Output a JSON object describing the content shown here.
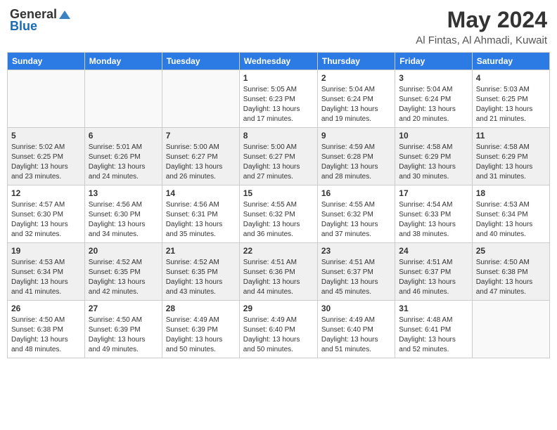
{
  "header": {
    "logo_general": "General",
    "logo_blue": "Blue",
    "month_title": "May 2024",
    "location": "Al Fintas, Al Ahmadi, Kuwait"
  },
  "days_of_week": [
    "Sunday",
    "Monday",
    "Tuesday",
    "Wednesday",
    "Thursday",
    "Friday",
    "Saturday"
  ],
  "weeks": [
    [
      {
        "day": "",
        "info": ""
      },
      {
        "day": "",
        "info": ""
      },
      {
        "day": "",
        "info": ""
      },
      {
        "day": "1",
        "info": "Sunrise: 5:05 AM\nSunset: 6:23 PM\nDaylight: 13 hours\nand 17 minutes."
      },
      {
        "day": "2",
        "info": "Sunrise: 5:04 AM\nSunset: 6:24 PM\nDaylight: 13 hours\nand 19 minutes."
      },
      {
        "day": "3",
        "info": "Sunrise: 5:04 AM\nSunset: 6:24 PM\nDaylight: 13 hours\nand 20 minutes."
      },
      {
        "day": "4",
        "info": "Sunrise: 5:03 AM\nSunset: 6:25 PM\nDaylight: 13 hours\nand 21 minutes."
      }
    ],
    [
      {
        "day": "5",
        "info": "Sunrise: 5:02 AM\nSunset: 6:25 PM\nDaylight: 13 hours\nand 23 minutes."
      },
      {
        "day": "6",
        "info": "Sunrise: 5:01 AM\nSunset: 6:26 PM\nDaylight: 13 hours\nand 24 minutes."
      },
      {
        "day": "7",
        "info": "Sunrise: 5:00 AM\nSunset: 6:27 PM\nDaylight: 13 hours\nand 26 minutes."
      },
      {
        "day": "8",
        "info": "Sunrise: 5:00 AM\nSunset: 6:27 PM\nDaylight: 13 hours\nand 27 minutes."
      },
      {
        "day": "9",
        "info": "Sunrise: 4:59 AM\nSunset: 6:28 PM\nDaylight: 13 hours\nand 28 minutes."
      },
      {
        "day": "10",
        "info": "Sunrise: 4:58 AM\nSunset: 6:29 PM\nDaylight: 13 hours\nand 30 minutes."
      },
      {
        "day": "11",
        "info": "Sunrise: 4:58 AM\nSunset: 6:29 PM\nDaylight: 13 hours\nand 31 minutes."
      }
    ],
    [
      {
        "day": "12",
        "info": "Sunrise: 4:57 AM\nSunset: 6:30 PM\nDaylight: 13 hours\nand 32 minutes."
      },
      {
        "day": "13",
        "info": "Sunrise: 4:56 AM\nSunset: 6:30 PM\nDaylight: 13 hours\nand 34 minutes."
      },
      {
        "day": "14",
        "info": "Sunrise: 4:56 AM\nSunset: 6:31 PM\nDaylight: 13 hours\nand 35 minutes."
      },
      {
        "day": "15",
        "info": "Sunrise: 4:55 AM\nSunset: 6:32 PM\nDaylight: 13 hours\nand 36 minutes."
      },
      {
        "day": "16",
        "info": "Sunrise: 4:55 AM\nSunset: 6:32 PM\nDaylight: 13 hours\nand 37 minutes."
      },
      {
        "day": "17",
        "info": "Sunrise: 4:54 AM\nSunset: 6:33 PM\nDaylight: 13 hours\nand 38 minutes."
      },
      {
        "day": "18",
        "info": "Sunrise: 4:53 AM\nSunset: 6:34 PM\nDaylight: 13 hours\nand 40 minutes."
      }
    ],
    [
      {
        "day": "19",
        "info": "Sunrise: 4:53 AM\nSunset: 6:34 PM\nDaylight: 13 hours\nand 41 minutes."
      },
      {
        "day": "20",
        "info": "Sunrise: 4:52 AM\nSunset: 6:35 PM\nDaylight: 13 hours\nand 42 minutes."
      },
      {
        "day": "21",
        "info": "Sunrise: 4:52 AM\nSunset: 6:35 PM\nDaylight: 13 hours\nand 43 minutes."
      },
      {
        "day": "22",
        "info": "Sunrise: 4:51 AM\nSunset: 6:36 PM\nDaylight: 13 hours\nand 44 minutes."
      },
      {
        "day": "23",
        "info": "Sunrise: 4:51 AM\nSunset: 6:37 PM\nDaylight: 13 hours\nand 45 minutes."
      },
      {
        "day": "24",
        "info": "Sunrise: 4:51 AM\nSunset: 6:37 PM\nDaylight: 13 hours\nand 46 minutes."
      },
      {
        "day": "25",
        "info": "Sunrise: 4:50 AM\nSunset: 6:38 PM\nDaylight: 13 hours\nand 47 minutes."
      }
    ],
    [
      {
        "day": "26",
        "info": "Sunrise: 4:50 AM\nSunset: 6:38 PM\nDaylight: 13 hours\nand 48 minutes."
      },
      {
        "day": "27",
        "info": "Sunrise: 4:50 AM\nSunset: 6:39 PM\nDaylight: 13 hours\nand 49 minutes."
      },
      {
        "day": "28",
        "info": "Sunrise: 4:49 AM\nSunset: 6:39 PM\nDaylight: 13 hours\nand 50 minutes."
      },
      {
        "day": "29",
        "info": "Sunrise: 4:49 AM\nSunset: 6:40 PM\nDaylight: 13 hours\nand 50 minutes."
      },
      {
        "day": "30",
        "info": "Sunrise: 4:49 AM\nSunset: 6:40 PM\nDaylight: 13 hours\nand 51 minutes."
      },
      {
        "day": "31",
        "info": "Sunrise: 4:48 AM\nSunset: 6:41 PM\nDaylight: 13 hours\nand 52 minutes."
      },
      {
        "day": "",
        "info": ""
      }
    ]
  ]
}
